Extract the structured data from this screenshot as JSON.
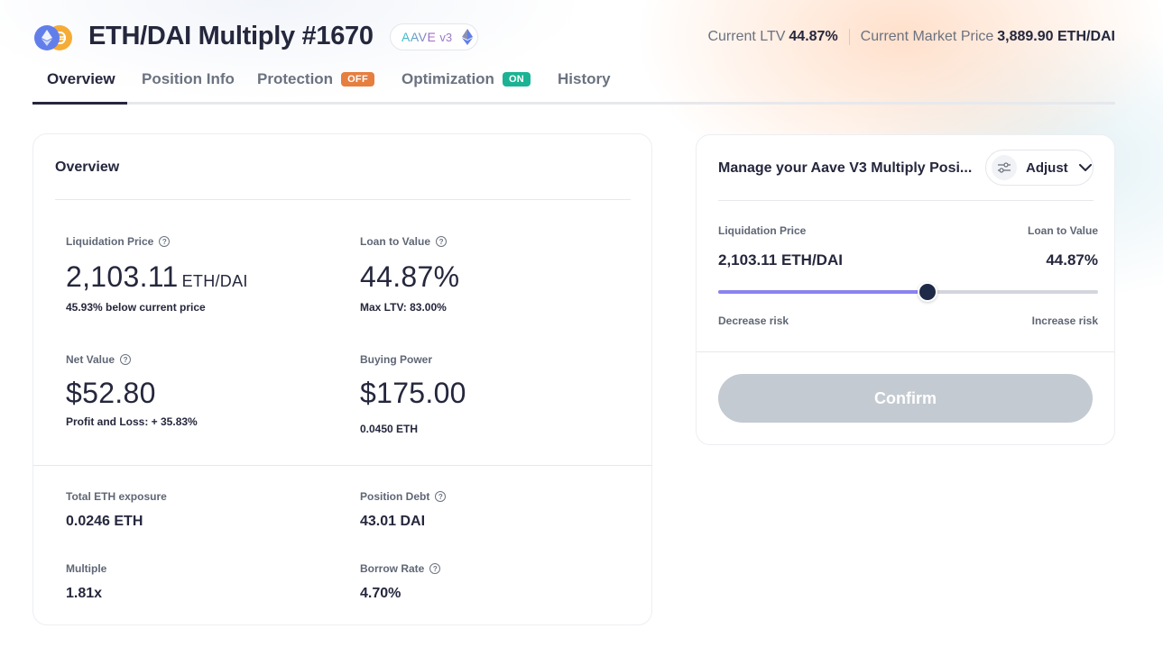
{
  "header": {
    "title": "ETH/DAI Multiply #1670",
    "protocol_name": "AAVE",
    "protocol_version": "v3",
    "token_icons": [
      "eth-icon",
      "dai-icon"
    ],
    "current_ltv_label": "Current LTV",
    "current_ltv_value": "44.87%",
    "market_price_label": "Current Market Price",
    "market_price_value": "3,889.90 ETH/DAI"
  },
  "tabs": [
    {
      "label": "Overview",
      "active": true
    },
    {
      "label": "Position Info"
    },
    {
      "label": "Protection",
      "badge": "OFF",
      "badge_color": "#e67e3f"
    },
    {
      "label": "Optimization",
      "badge": "ON",
      "badge_color": "#1bb394"
    },
    {
      "label": "History"
    }
  ],
  "overview": {
    "title": "Overview",
    "liquidation_price": {
      "label": "Liquidation Price",
      "value": "2,103.11",
      "unit": "ETH/DAI",
      "sub": "45.93% below current price"
    },
    "loan_to_value": {
      "label": "Loan to Value",
      "value": "44.87%",
      "sub": "Max LTV: 83.00%"
    },
    "net_value": {
      "label": "Net Value",
      "value": "$52.80",
      "sub": "Profit and Loss: + 35.83%"
    },
    "buying_power": {
      "label": "Buying Power",
      "value": "$175.00",
      "sub": "0.0450 ETH"
    },
    "total_exposure": {
      "label": "Total ETH exposure",
      "value": "0.0246 ETH"
    },
    "position_debt": {
      "label": "Position Debt",
      "value": "43.01 DAI"
    },
    "multiple": {
      "label": "Multiple",
      "value": "1.81x"
    },
    "borrow_rate": {
      "label": "Borrow Rate",
      "value": "4.70%"
    }
  },
  "manage": {
    "title": "Manage your Aave V3 Multiply Posi...",
    "adjust_label": "Adjust",
    "liq_price_label": "Liquidation Price",
    "liq_price_value": "2,103.11 ETH/DAI",
    "ltv_label": "Loan to Value",
    "ltv_value": "44.87%",
    "slider_fraction": 0.55,
    "decrease_label": "Decrease risk",
    "increase_label": "Increase risk",
    "confirm_label": "Confirm"
  },
  "colors": {
    "text": "#25273d",
    "slider_fill": "#8b83f0",
    "slider_thumb": "#1e2a47",
    "confirm_disabled": "#c3cad1",
    "eth": "#627eea",
    "dai": "#f5ac37"
  }
}
